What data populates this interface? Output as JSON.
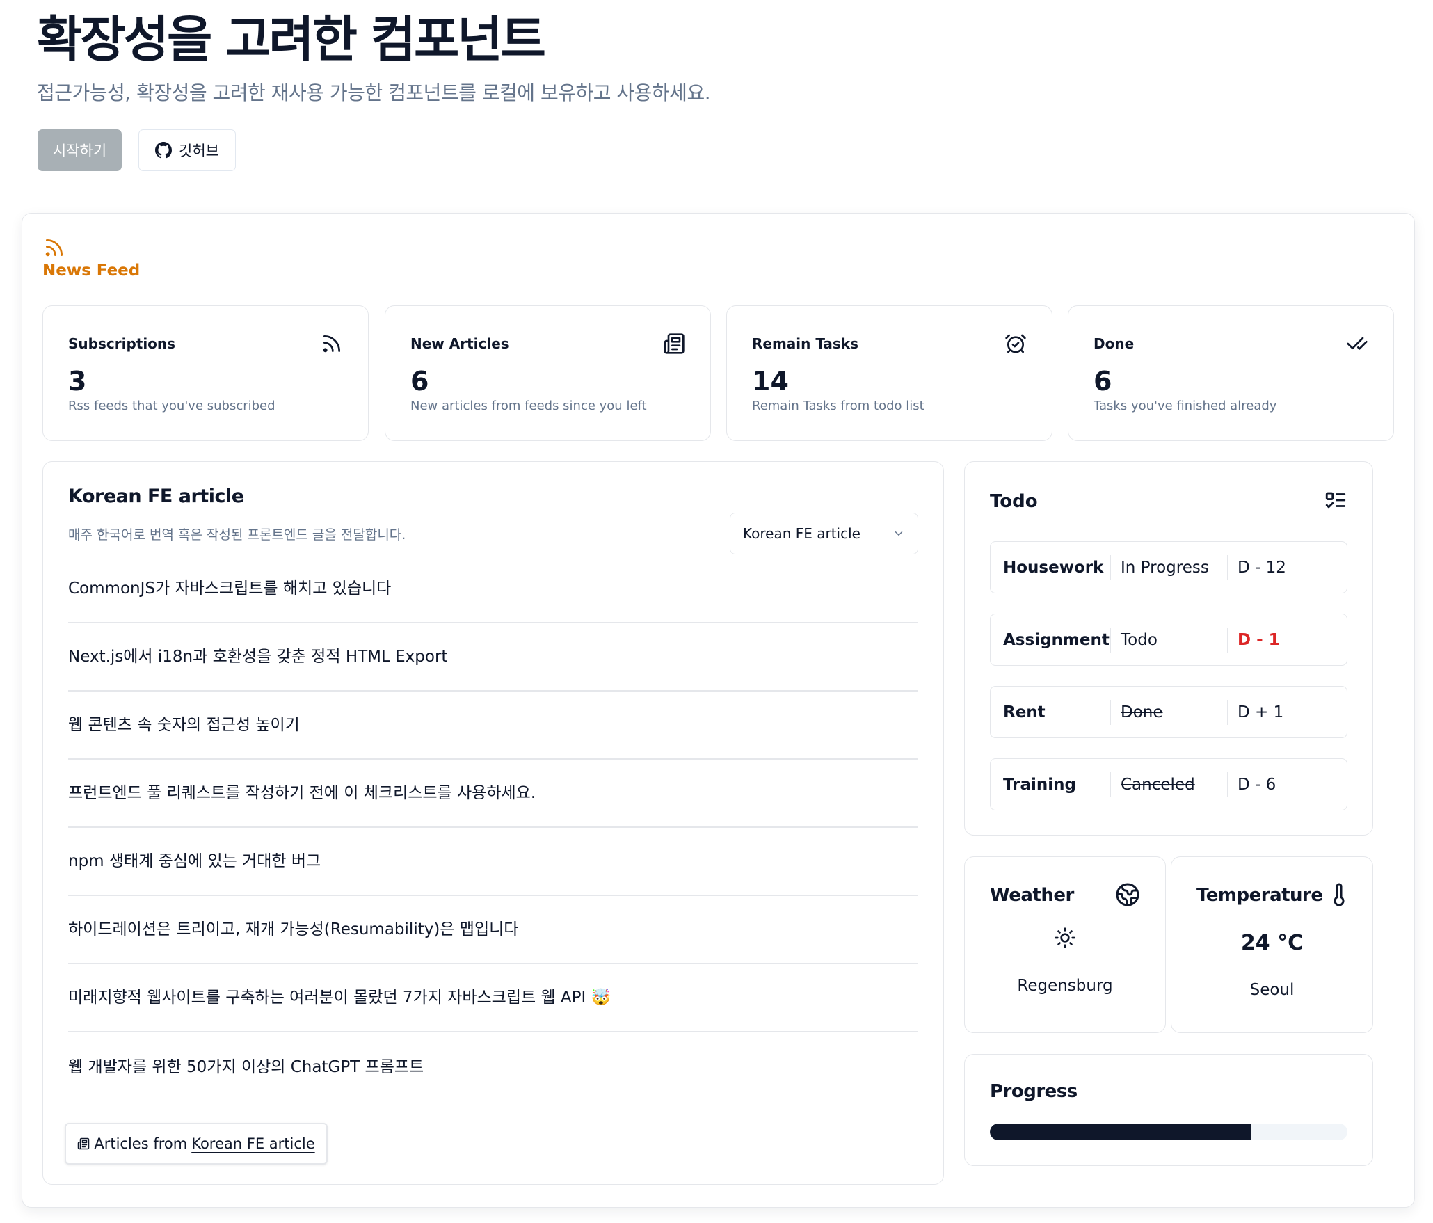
{
  "hero": {
    "title": "확장성을 고려한 컴포넌트",
    "subtitle": "접근가능성, 확장성을 고려한 재사용 가능한 컴포넌트를 로컬에 보유하고 사용하세요.",
    "start_label": "시작하기",
    "github_label": "깃허브"
  },
  "feed": {
    "title": "News Feed",
    "icon": "rss-icon",
    "accent": "#d97706"
  },
  "stats": [
    {
      "label": "Subscriptions",
      "value": "3",
      "desc": "Rss feeds that you've subscribed",
      "icon": "rss-icon"
    },
    {
      "label": "New Articles",
      "value": "6",
      "desc": "New articles from feeds since you left",
      "icon": "newspaper-icon"
    },
    {
      "label": "Remain Tasks",
      "value": "14",
      "desc": "Remain Tasks from todo list",
      "icon": "alarm-clock-icon"
    },
    {
      "label": "Done",
      "value": "6",
      "desc": "Tasks you've finished already",
      "icon": "double-check-icon"
    }
  ],
  "articles": {
    "title": "Korean FE article",
    "subtitle": "매주 한국어로 번역 혹은 작성된 프론트엔드 글을 전달합니다.",
    "select_value": "Korean FE article",
    "items": [
      "CommonJS가 자바스크립트를 해치고 있습니다",
      "Next.js에서 i18n과 호환성을 갖춘 정적 HTML Export",
      "웹 콘텐츠 속 숫자의 접근성 높이기",
      "프런트엔드 풀 리퀘스트를 작성하기 전에 이 체크리스트를 사용하세요.",
      "npm 생태계 중심에 있는 거대한 버그",
      "하이드레이션은 트리이고, 재개 가능성(Resumability)은 맵입니다",
      "미래지향적 웹사이트를 구축하는 여러분이 몰랐던 7가지 자바스크립트 웹 API 🤯",
      "웹 개발자를 위한 50가지 이상의 ChatGPT 프롬프트"
    ],
    "button_prefix": "Articles from",
    "button_link": "Korean FE article"
  },
  "todo": {
    "title": "Todo",
    "rows": [
      {
        "name": "Housework",
        "status": "In Progress",
        "due": "D - 12"
      },
      {
        "name": "Assignment",
        "status": "Todo",
        "due": "D - 1"
      },
      {
        "name": "Rent",
        "status": "Done",
        "due": "D + 1"
      },
      {
        "name": "Training",
        "status": "Canceled",
        "due": "D - 6"
      }
    ],
    "urgent_color": "#dc2626"
  },
  "weather": {
    "title": "Weather",
    "city": "Regensburg",
    "icon": "sun-icon"
  },
  "temperature": {
    "title": "Temperature",
    "value": "24 °C",
    "city": "Seoul"
  },
  "progress": {
    "title": "Progress",
    "value_pct": 73
  }
}
